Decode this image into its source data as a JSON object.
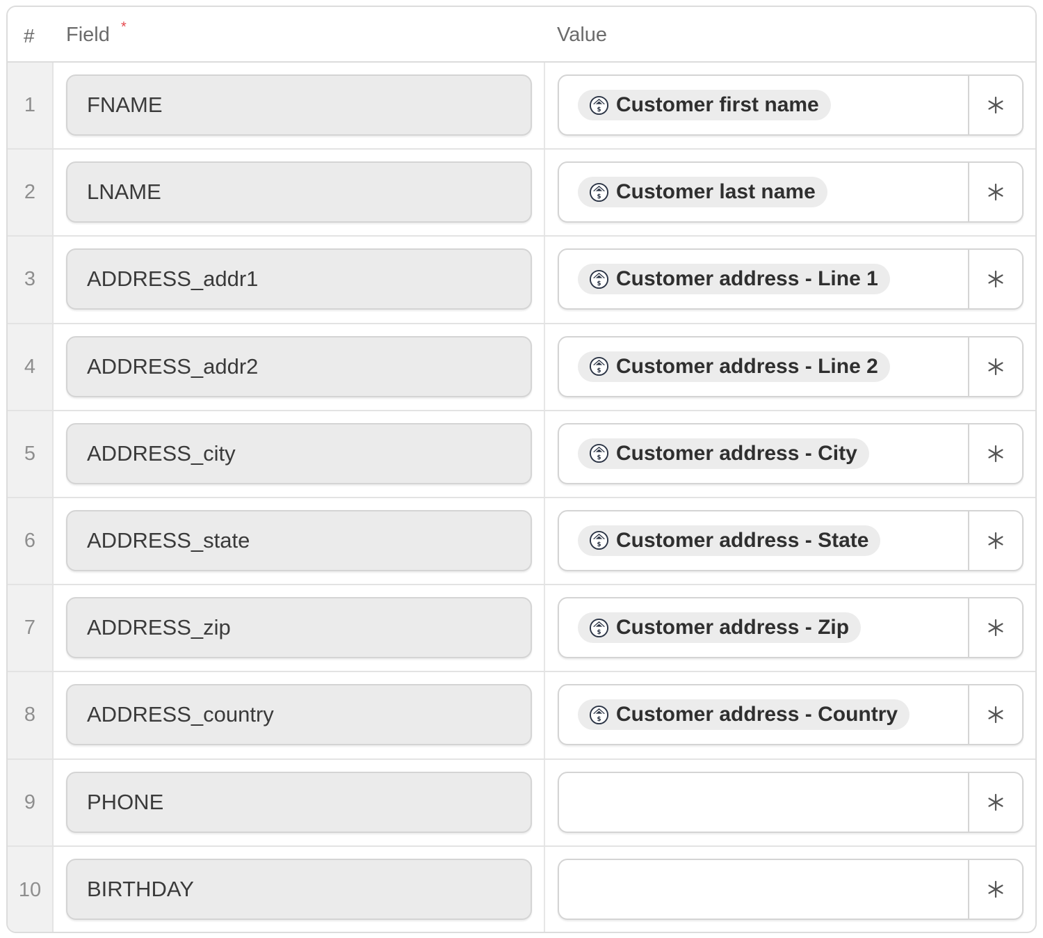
{
  "header": {
    "num_label": "#",
    "field_label": "Field",
    "required_mark": "*",
    "value_label": "Value"
  },
  "rows": [
    {
      "num": "1",
      "field": "FNAME",
      "value": "Customer first name"
    },
    {
      "num": "2",
      "field": "LNAME",
      "value": "Customer last name"
    },
    {
      "num": "3",
      "field": "ADDRESS_addr1",
      "value": "Customer address - Line 1"
    },
    {
      "num": "4",
      "field": "ADDRESS_addr2",
      "value": "Customer address - Line 2"
    },
    {
      "num": "5",
      "field": "ADDRESS_city",
      "value": "Customer address - City"
    },
    {
      "num": "6",
      "field": "ADDRESS_state",
      "value": "Customer address - State"
    },
    {
      "num": "7",
      "field": "ADDRESS_zip",
      "value": "Customer address - Zip"
    },
    {
      "num": "8",
      "field": "ADDRESS_country",
      "value": "Customer address - Country"
    },
    {
      "num": "9",
      "field": "PHONE",
      "value": ""
    },
    {
      "num": "10",
      "field": "BIRTHDAY",
      "value": ""
    }
  ],
  "icons": {
    "pill_icon": "customer-variable-icon",
    "star_icon": "asterisk-icon"
  },
  "colors": {
    "required": "#e5484d",
    "field_bg": "#ebebeb",
    "pill_bg": "#ececec"
  }
}
